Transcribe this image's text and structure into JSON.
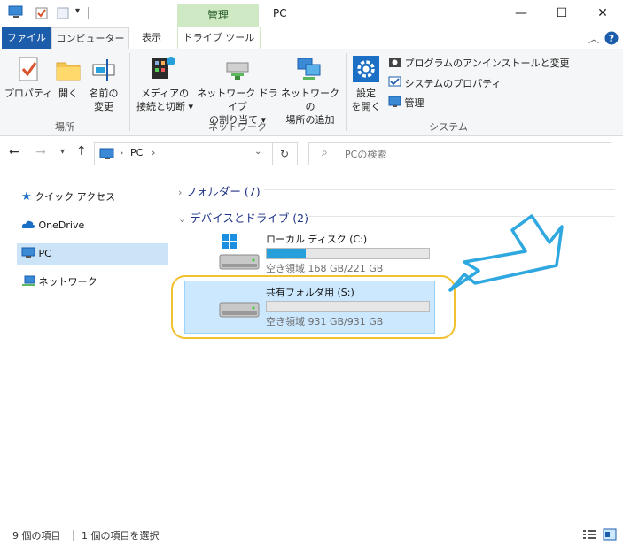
{
  "window": {
    "title": "PC",
    "contextual_tab": "管理",
    "min_symbol": "—",
    "max_symbol": "☐",
    "close_symbol": "✕"
  },
  "tabs": {
    "file": "ファイル",
    "computer": "コンピューター",
    "view": "表示",
    "drive_tools": "ドライブ ツール"
  },
  "ribbon": {
    "location": {
      "label": "場所",
      "properties": "プロパティ",
      "open": "開く",
      "rename_l1": "名前の",
      "rename_l2": "変更"
    },
    "network": {
      "label": "ネットワーク",
      "media_l1": "メディアの",
      "media_l2": "接続と切断",
      "map_l1": "ネットワーク ドライブ",
      "map_l2": "の割り当て",
      "add_l1": "ネットワークの",
      "add_l2": "場所の追加"
    },
    "system": {
      "label": "システム",
      "settings_l1": "設定",
      "settings_l2": "を開く",
      "uninstall": "プログラムのアンインストールと変更",
      "sys_props": "システムのプロパティ",
      "manage": "管理"
    }
  },
  "nav": {
    "address_root": "PC",
    "search_placeholder": "PCの検索"
  },
  "sidebar": [
    {
      "label": "クイック アクセス"
    },
    {
      "label": "OneDrive"
    },
    {
      "label": "PC"
    },
    {
      "label": "ネットワーク"
    }
  ],
  "content": {
    "folders": "フォルダー (7)",
    "devices": "デバイスとドライブ (2)",
    "drives": [
      {
        "name": "ローカル ディスク (C:)",
        "free": "空き領域 168 GB/221 GB",
        "used_fraction": 0.24
      },
      {
        "name": "共有フォルダ用 (S:)",
        "free": "空き領域 931 GB/931 GB",
        "used_fraction": 0.0
      }
    ]
  },
  "status": {
    "count": "9 個の項目",
    "selected": "1 個の項目を選択"
  },
  "colors": {
    "accent": "#1b5cab",
    "highlight_ring": "#f2c130",
    "arrow": "#2fa8e0",
    "selection": "#cce8ff",
    "bar_fill": "#26a0da"
  }
}
